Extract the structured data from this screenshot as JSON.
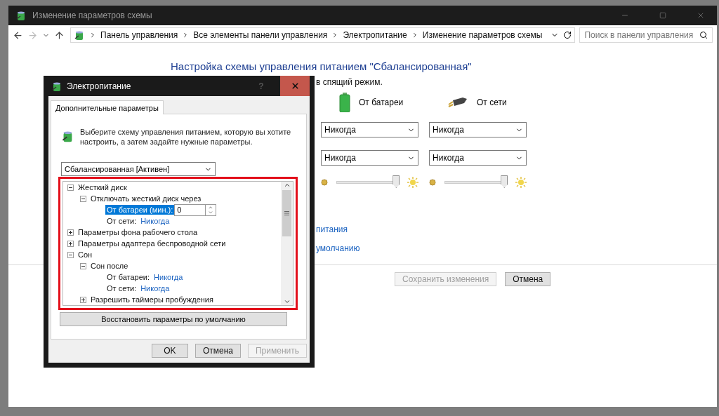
{
  "window": {
    "title": "Изменение параметров схемы"
  },
  "address_bar": {
    "breadcrumbs": [
      "Панель управления",
      "Все элементы панели управления",
      "Электропитание",
      "Изменение параметров схемы"
    ]
  },
  "search": {
    "placeholder": "Поиск в панели управления"
  },
  "main": {
    "heading": "Настройка схемы управления питанием \"Сбалансированная\"",
    "sleep_text": "в спящий режим.",
    "columns": [
      {
        "label": "От батареи",
        "kind": "battery"
      },
      {
        "label": "От сети",
        "kind": "plug"
      }
    ],
    "setting_rows": [
      {
        "values": [
          "Никогда",
          "Никогда"
        ]
      },
      {
        "values": [
          "Никогда",
          "Никогда"
        ]
      }
    ],
    "brightness": [
      {
        "level": 0.97
      },
      {
        "level": 0.97
      }
    ],
    "links": [
      "питания",
      "умолчанию"
    ],
    "buttons": [
      {
        "label": "Сохранить изменения",
        "disabled": true
      },
      {
        "label": "Отмена",
        "disabled": false
      }
    ]
  },
  "dialog": {
    "title": "Электропитание",
    "help_label": "?",
    "tab": {
      "label": "Дополнительные параметры",
      "selected": true
    },
    "description": "Выберите схему управления питанием, которую вы хотите настроить, а затем задайте нужные параметры.",
    "plan_select": "Сбалансированная [Активен]",
    "tree": [
      {
        "label": "Жесткий диск",
        "expanded": true,
        "selected": false,
        "children": [
          {
            "label": "Отключать жесткий диск через",
            "expanded": true,
            "selected": false,
            "children": [
              {
                "label": "От батареи (мин.):",
                "kind": "spin",
                "value": "0",
                "selected": true
              },
              {
                "label": "От сети:",
                "kind": "value",
                "value": "Никогда",
                "selected": false
              }
            ]
          }
        ]
      },
      {
        "label": "Параметры фона рабочего стола",
        "expanded": false,
        "selected": false
      },
      {
        "label": "Параметры адаптера беспроводной сети",
        "expanded": false,
        "selected": false
      },
      {
        "label": "Сон",
        "expanded": true,
        "selected": false,
        "children": [
          {
            "label": "Сон после",
            "expanded": true,
            "selected": false,
            "children": [
              {
                "label": "От батареи:",
                "kind": "value",
                "value": "Никогда",
                "selected": false
              },
              {
                "label": "От сети:",
                "kind": "value",
                "value": "Никогда",
                "selected": false
              }
            ]
          },
          {
            "label": "Разрешить таймеры пробуждения",
            "expanded": false,
            "selected": false
          }
        ]
      }
    ],
    "restore_button": "Восстановить параметры по умолчанию",
    "buttons": [
      {
        "label": "OK",
        "disabled": false
      },
      {
        "label": "Отмена",
        "disabled": false
      },
      {
        "label": "Применить",
        "disabled": true
      }
    ]
  }
}
